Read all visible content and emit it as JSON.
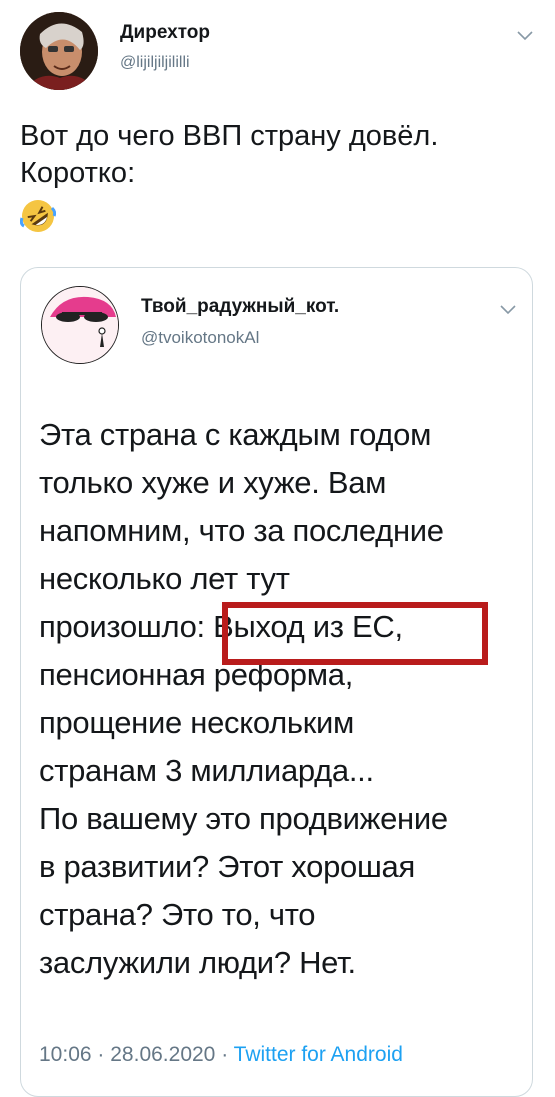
{
  "outer_tweet": {
    "author_name": "Дирехтор",
    "author_handle": "@lijiljiljililli",
    "text": "Вот до чего ВВП страну довёл.\nКоротко:",
    "emoji_icon": "rolling-on-floor-laughing-emoji"
  },
  "quoted_tweet": {
    "author_name": "Твой_радужный_кот.",
    "author_handle": "@tvoikotonokAl",
    "lines": [
      "Эта страна с каждым годом",
      "только хуже и хуже. Вам",
      "напомним, что за последние",
      "несколько лет тут",
      "произошло: Выход из ЕС,",
      "пенсионная реформа,",
      "прощение нескольким",
      "странам 3 миллиарда...",
      "По вашему это продвижение",
      "в развитии? Этот хорошая",
      "страна? Это то, что",
      "заслужили люди? Нет."
    ],
    "time": "10:06",
    "separator": "·",
    "date": "28.06.2020",
    "source": "Twitter for Android"
  },
  "colors": {
    "highlight_box": "#b91c1c",
    "link": "#1da1f2",
    "secondary_text": "#657786"
  }
}
